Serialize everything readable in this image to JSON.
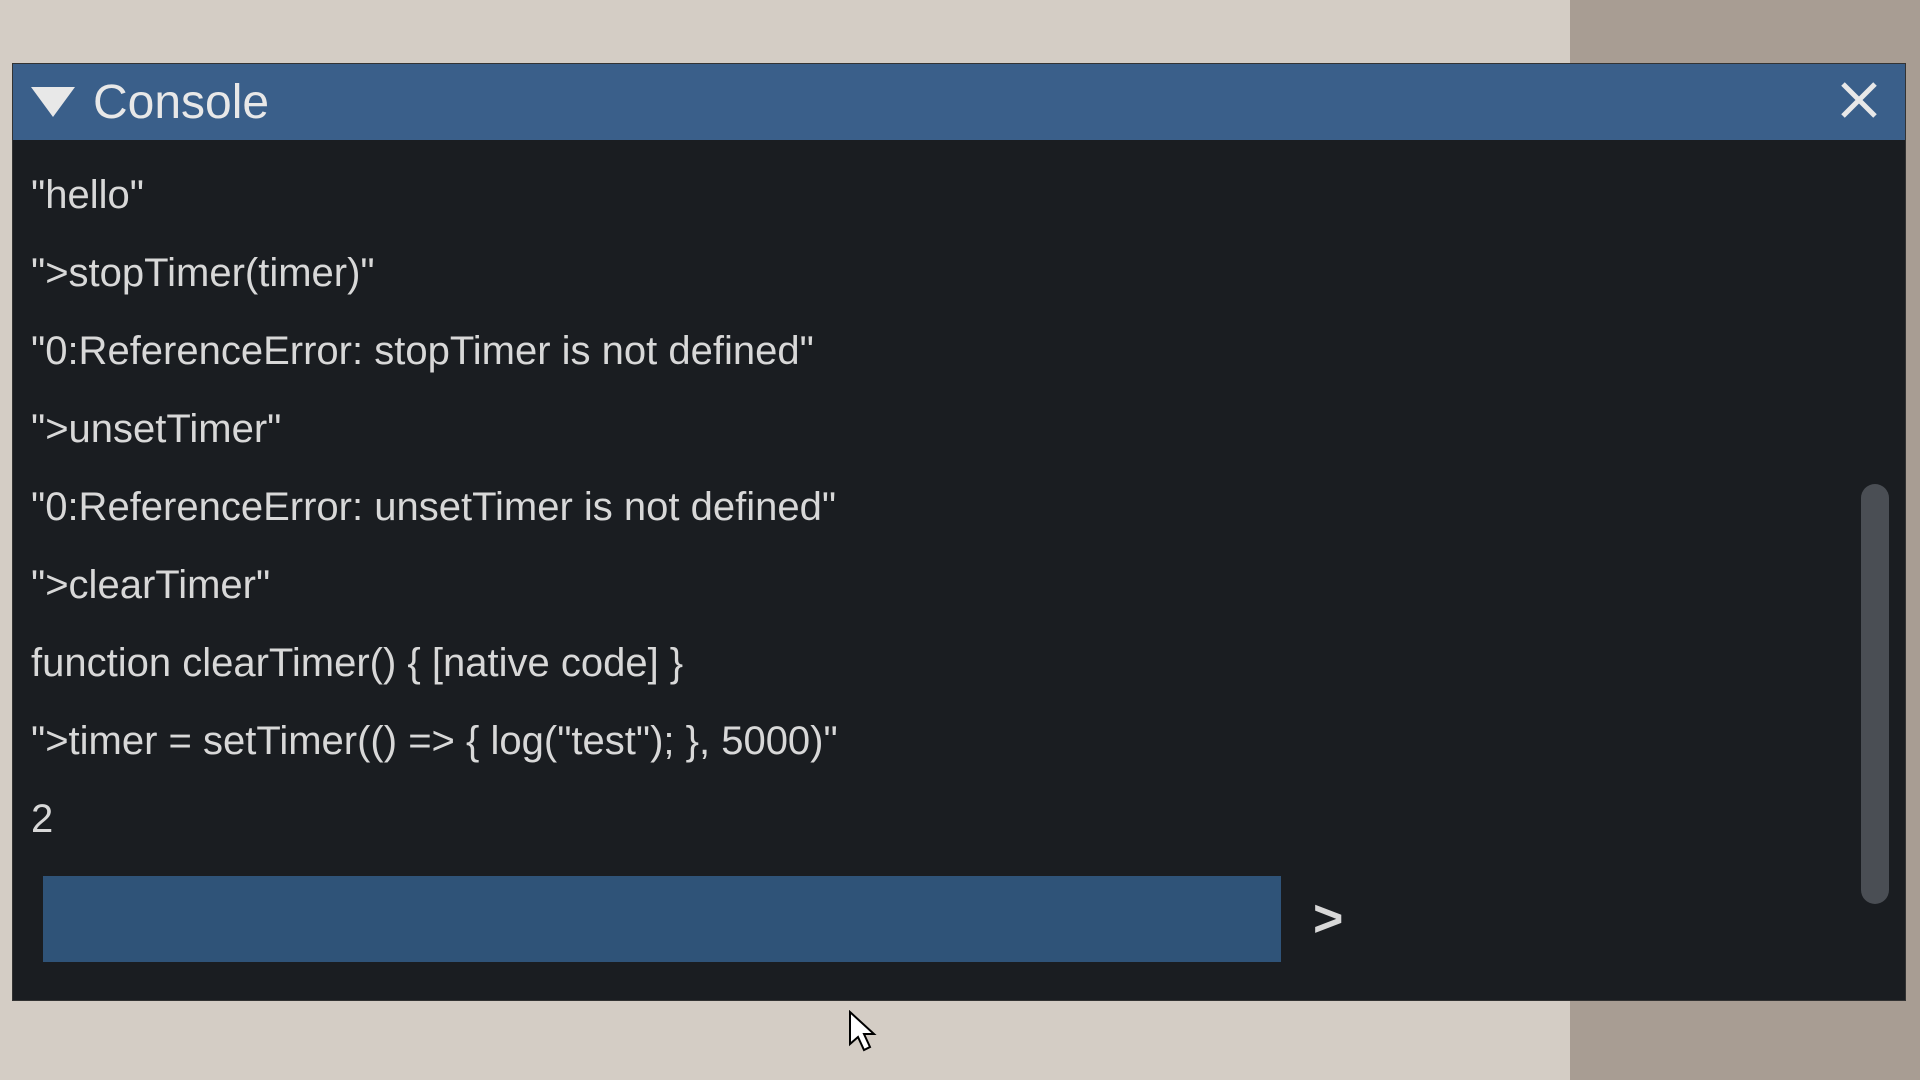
{
  "header": {
    "title": "Console"
  },
  "output": {
    "lines": [
      "\"hello\"",
      "\">stopTimer(timer)\"",
      "\"0:ReferenceError: stopTimer is not defined\"",
      "\">unsetTimer\"",
      "\"0:ReferenceError: unsetTimer is not defined\"",
      "\">clearTimer\"",
      "function clearTimer() { [native code] }",
      "\">timer = setTimer(() => { log(\"test\"); }, 5000)\"",
      "2"
    ]
  },
  "input": {
    "value": "",
    "submit_label": ">"
  },
  "colors": {
    "header_bg": "#3a5f8a",
    "panel_bg": "#1a1d21",
    "input_bg": "#2f5378",
    "text": "#d8d8d8"
  }
}
